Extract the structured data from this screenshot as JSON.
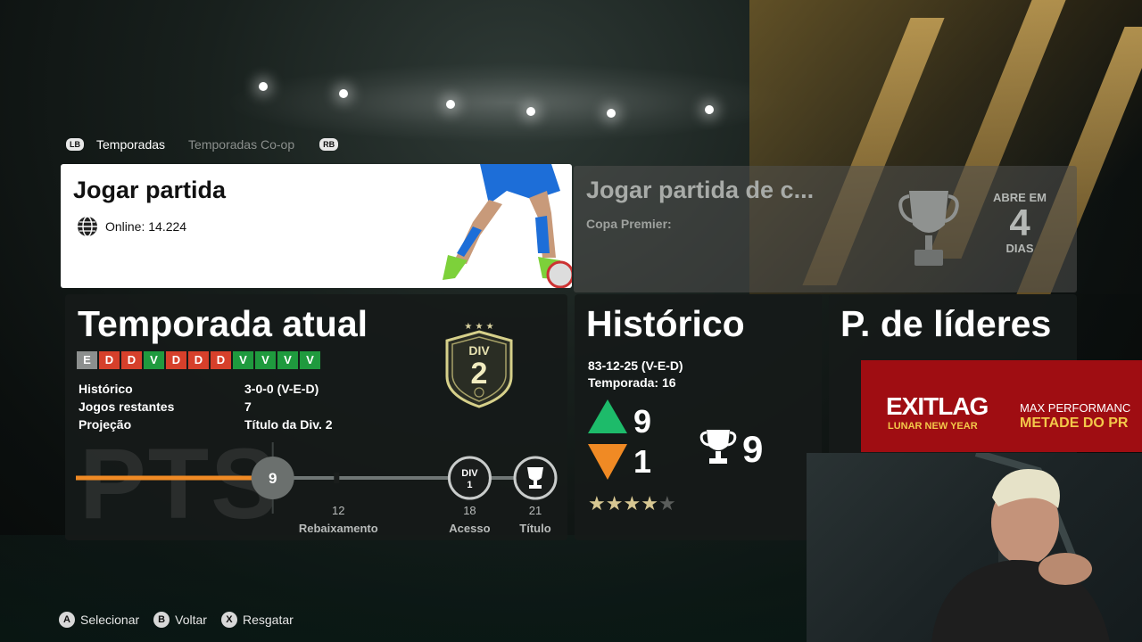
{
  "tabs": {
    "left_bumper": "LB",
    "right_bumper": "RB",
    "items": [
      {
        "label": "Temporadas",
        "active": true
      },
      {
        "label": "Temporadas Co-op",
        "active": false
      }
    ]
  },
  "play_card": {
    "title": "Jogar partida",
    "online_label": "Online: 14.224"
  },
  "coop_card": {
    "title": "Jogar partida de c...",
    "subtitle": "Copa Premier:",
    "opens_label": "ABRE EM",
    "opens_value": "4",
    "opens_unit": "DIAS"
  },
  "season": {
    "title": "Temporada atual",
    "results": [
      "E",
      "D",
      "D",
      "V",
      "D",
      "D",
      "D",
      "V",
      "V",
      "V",
      "V"
    ],
    "stats": [
      {
        "label": "Histórico",
        "value": "3-0-0 (V-E-D)"
      },
      {
        "label": "Jogos restantes",
        "value": "7"
      },
      {
        "label": "Projeção",
        "value": "Título da Div. 2"
      }
    ],
    "division_label": "DIV",
    "division_number": "2",
    "pts_label": "PTS",
    "current_points": 9,
    "max_points": 21,
    "milestones": [
      {
        "points": 12,
        "label": "Rebaixamento"
      },
      {
        "points": 18,
        "label": "Acesso",
        "badge_top": "DIV",
        "badge_bottom": "1"
      },
      {
        "points": 21,
        "label": "Título"
      }
    ]
  },
  "history": {
    "title": "Histórico",
    "record": "83-12-25 (V-E-D)",
    "seasons": "Temporada: 16",
    "promotions": "9",
    "relegations": "1",
    "titles": "9",
    "stars_filled": 4,
    "stars_total": 5
  },
  "leaders": {
    "title": "P. de líderes"
  },
  "ad": {
    "brand": "EXITLAG",
    "sub": "LUNAR NEW YEAR",
    "line1": "MAX PERFORMANC",
    "line2": "METADE DO PR"
  },
  "footer": {
    "hints": [
      {
        "button": "A",
        "label": "Selecionar"
      },
      {
        "button": "B",
        "label": "Voltar"
      },
      {
        "button": "X",
        "label": "Resgatar"
      }
    ]
  },
  "colors": {
    "loss": "#d6402b",
    "win": "#1f9a3e",
    "draw": "#8c8f8e",
    "progress": "#f08a24",
    "promotion": "#1dbb6a",
    "ad_bg": "#9f0d12"
  }
}
